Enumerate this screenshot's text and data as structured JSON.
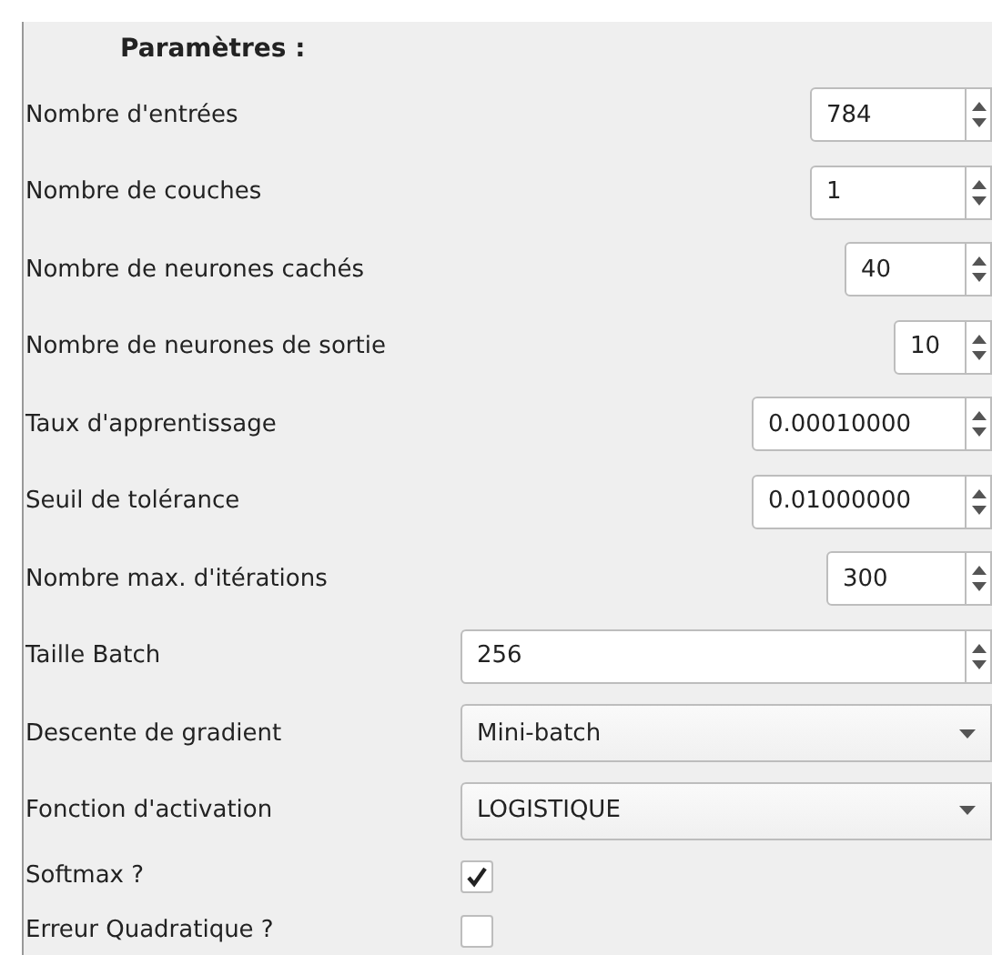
{
  "title": "Paramètres :",
  "fields": [
    {
      "kind": "spin",
      "label": "Nombre d'entrées",
      "value": "784"
    },
    {
      "kind": "spin",
      "label": "Nombre de couches",
      "value": "1"
    },
    {
      "kind": "spin",
      "label": "Nombre de neurones cachés",
      "value": "40"
    },
    {
      "kind": "spin",
      "label": "Nombre de neurones de sortie",
      "value": "10"
    },
    {
      "kind": "spin",
      "label": "Taux d'apprentissage",
      "value": "0.00010000"
    },
    {
      "kind": "spin",
      "label": "Seuil de tolérance",
      "value": "0.01000000"
    },
    {
      "kind": "spin",
      "label": "Nombre max. d'itérations",
      "value": "300"
    },
    {
      "kind": "widespin",
      "label": "Taille Batch",
      "value": "256"
    },
    {
      "kind": "combo",
      "label": "Descente de gradient",
      "value": "Mini-batch"
    },
    {
      "kind": "combo",
      "label": "Fonction d'activation",
      "value": "LOGISTIQUE"
    },
    {
      "kind": "check",
      "label": "Softmax ?",
      "checked": true
    },
    {
      "kind": "check",
      "label": "Erreur Quadratique ?",
      "checked": false
    }
  ]
}
